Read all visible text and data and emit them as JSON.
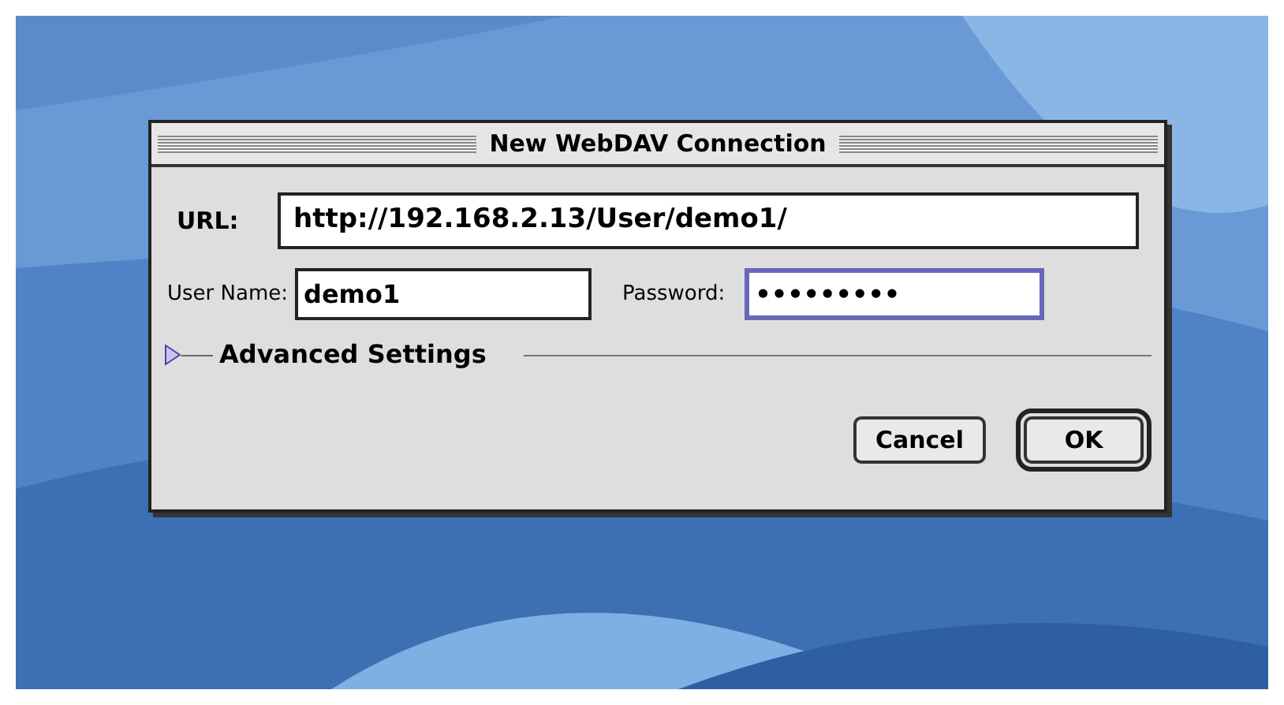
{
  "dialog": {
    "title": "New WebDAV Connection"
  },
  "url": {
    "label": "URL:",
    "value": "http://192.168.2.13/User/demo1/"
  },
  "user_name": {
    "label": "User Name:",
    "value": "demo1",
    "focused": false
  },
  "password": {
    "label": "Password:",
    "value": "•••••••••",
    "focused": true
  },
  "advanced": {
    "label": "Advanced Settings",
    "expanded": false
  },
  "buttons": [
    {
      "label": "Cancel",
      "default": false
    },
    {
      "label": "OK",
      "default": true
    }
  ]
}
